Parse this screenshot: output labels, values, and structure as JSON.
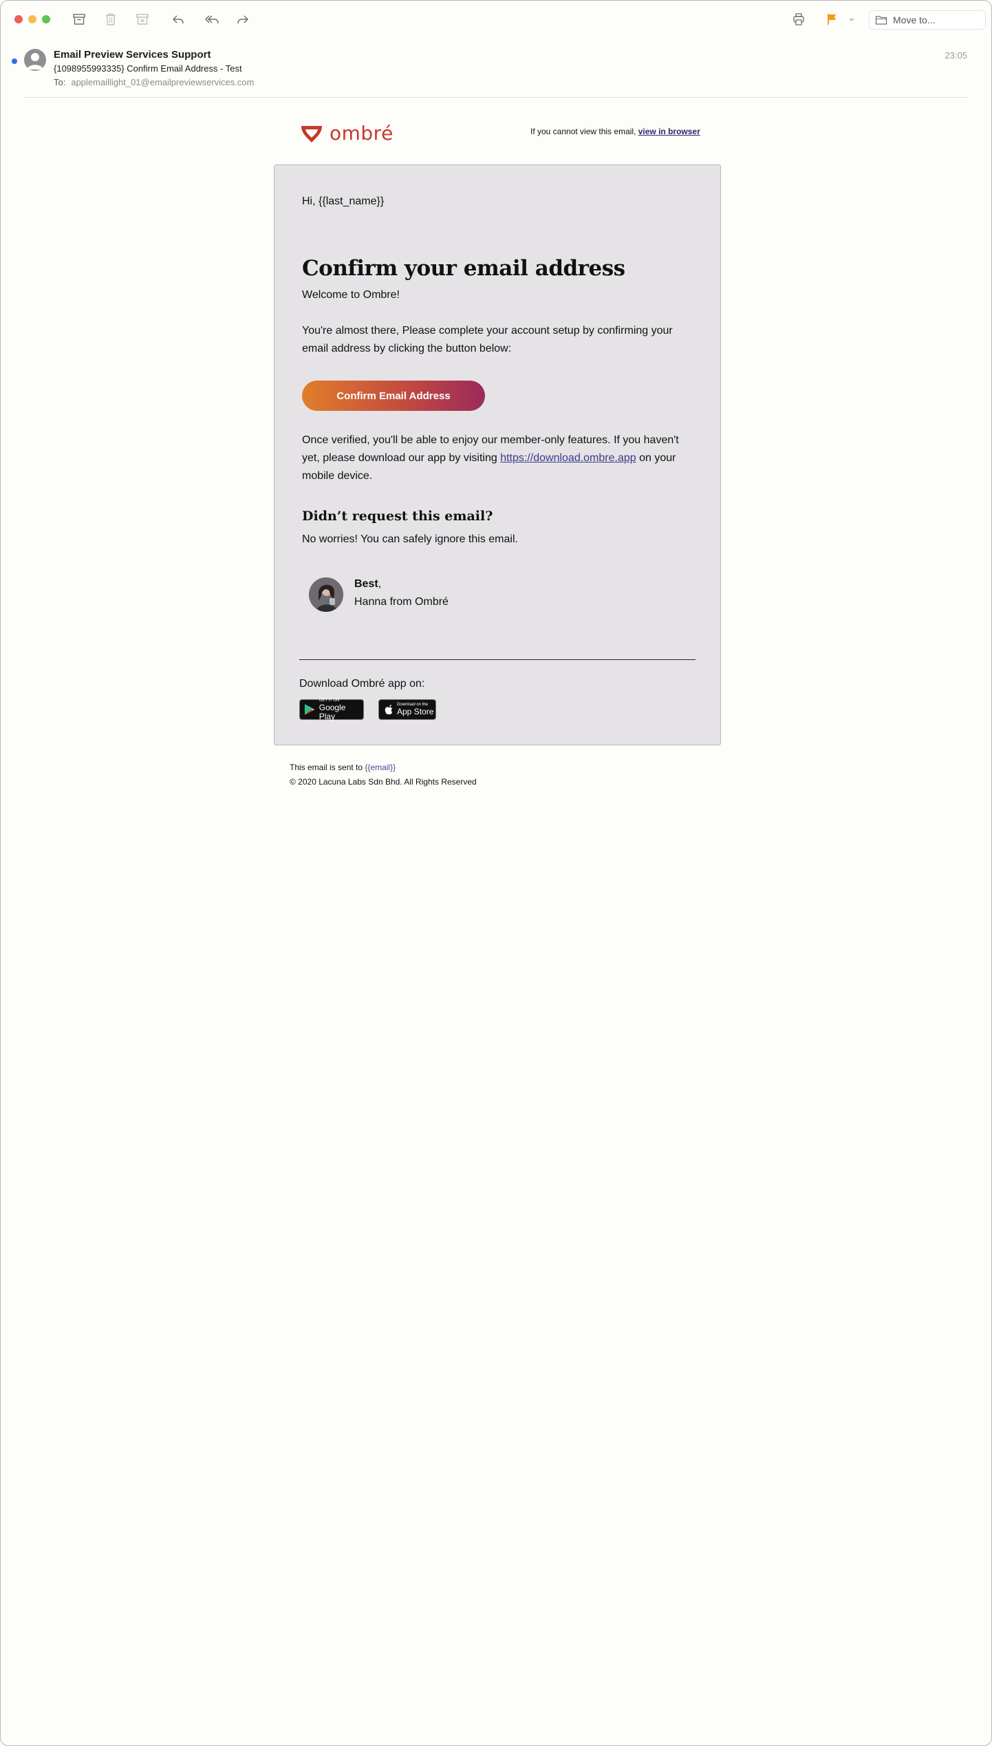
{
  "toolbar": {
    "move_to_label": "Move to...",
    "icons": [
      "archive-icon",
      "trash-icon",
      "junk-icon",
      "reply-icon",
      "reply-all-icon",
      "forward-icon",
      "print-icon",
      "flag-icon",
      "chevron-down-icon",
      "folder-icon"
    ],
    "colors": {
      "close": "#ee5f57",
      "minimize": "#f5bd4f",
      "zoom": "#5fc453",
      "flag": "#f39c12"
    }
  },
  "message": {
    "from": "Email Preview Services Support",
    "subject": "{1098955993335} Confirm Email Address - Test",
    "to_label": "To:",
    "to_address": "applemaillight_01@emailpreviewservices.com",
    "time": "23:05"
  },
  "email": {
    "brand": "ombré",
    "view_prefix": "If you cannot view this email,",
    "view_link": "view in browser",
    "greeting": "Hi, {{last_name}}",
    "heading": "Confirm your email address",
    "welcome": "Welcome to Ombre!",
    "intro": "You're almost there, Please complete your account setup by confirming your email address by clicking the button below:",
    "cta_label": "Confirm Email Address",
    "verified_before": "Once verified, you'll be able to enjoy our member-only features. If you haven't yet, please download our app by visiting",
    "app_link": "https://download.ombre.app",
    "verified_after": "on your mobile device.",
    "subheading": "Didn’t request this email?",
    "ignore_text": "No worries! You can safely ignore this email.",
    "sign_bold": "Best",
    "sign_comma": ",",
    "sign_name": "Hanna from Ombré",
    "download_label": "Download Ombré app on:",
    "google_small": "GET IT ON",
    "google_big": "Google Play",
    "apple_small": "Download on the",
    "apple_big": "App Store",
    "footer_prefix": "This email is sent to",
    "footer_email": "{{email}}",
    "copyright": "© 2020 Lacuna Labs Sdn Bhd. All Rights Reserved"
  }
}
